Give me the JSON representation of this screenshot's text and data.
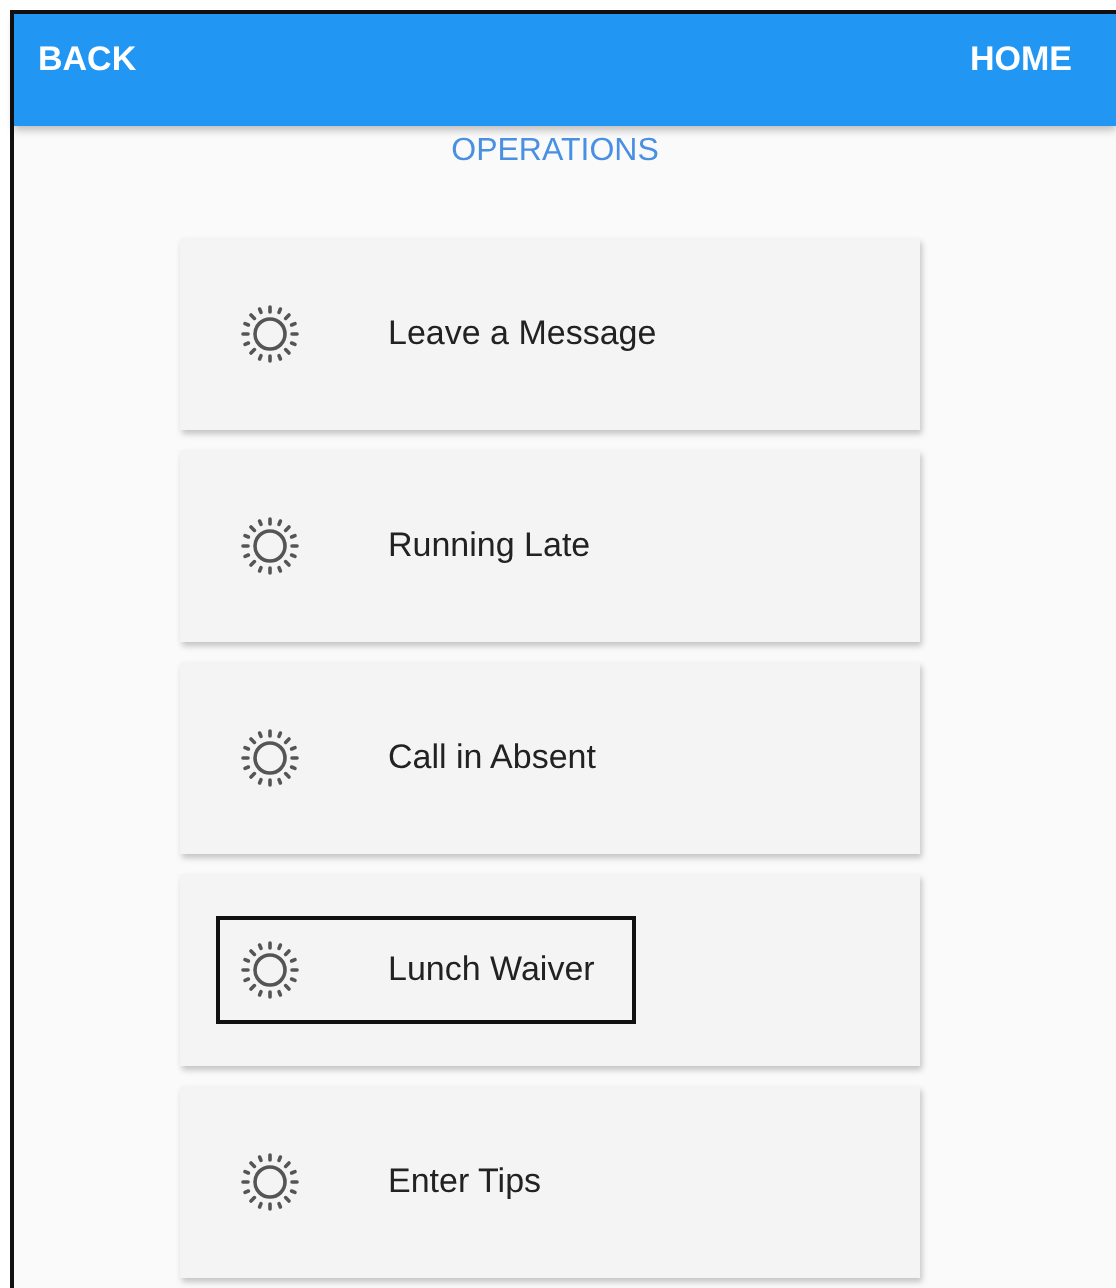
{
  "header": {
    "back": "BACK",
    "home": "HOME"
  },
  "section_title": "OPERATIONS",
  "items": [
    {
      "label": "Leave a Message",
      "highlighted": false
    },
    {
      "label": "Running Late",
      "highlighted": false
    },
    {
      "label": "Call in Absent",
      "highlighted": false
    },
    {
      "label": "Lunch Waiver",
      "highlighted": true
    },
    {
      "label": "Enter Tips",
      "highlighted": false
    }
  ]
}
